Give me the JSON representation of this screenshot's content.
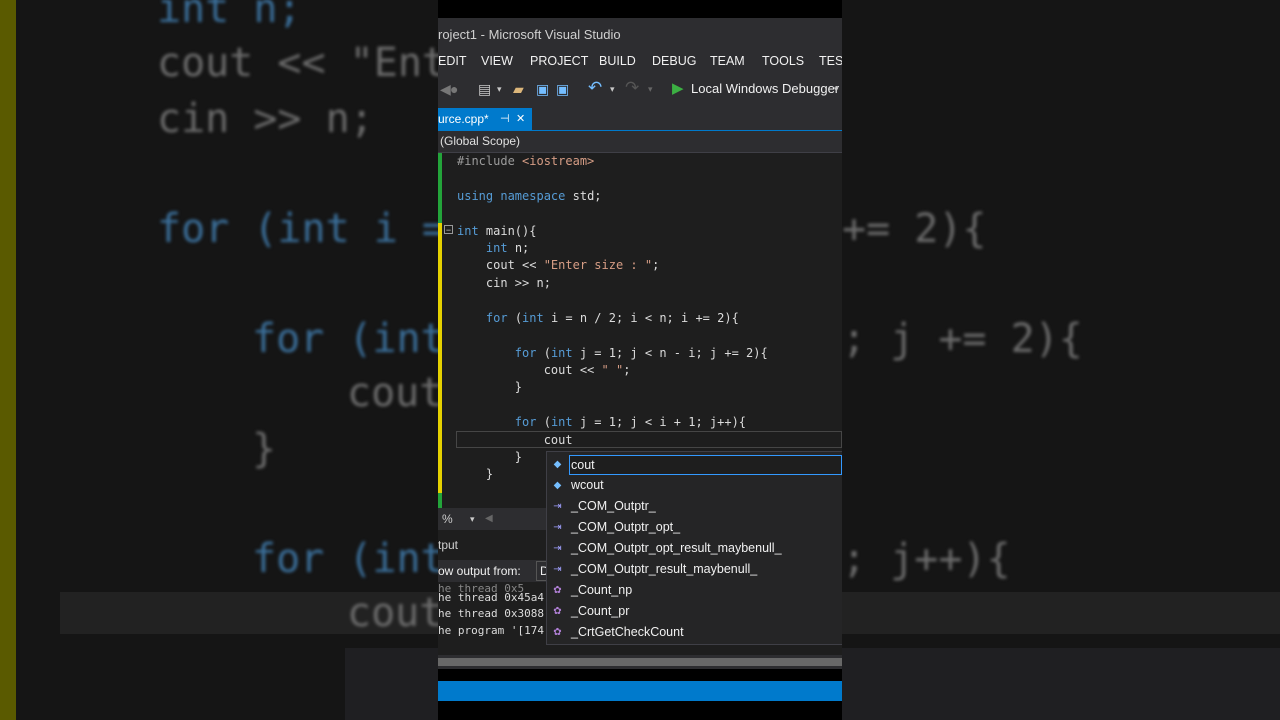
{
  "window": {
    "title": "roject1 - Microsoft Visual Studio"
  },
  "menu": [
    "EDIT",
    "VIEW",
    "PROJECT",
    "BUILD",
    "DEBUG",
    "TEAM",
    "TOOLS",
    "TEST"
  ],
  "toolbar": {
    "debugger_label": "Local Windows Debugger"
  },
  "tab": {
    "label": "urce.cpp*",
    "pin": "⊣",
    "close": "✕"
  },
  "scope": {
    "label": "(Global Scope)"
  },
  "code": [
    "#include <iostream>",
    "",
    "using namespace std;",
    "",
    "int main(){",
    "    int n;",
    "    cout << \"Enter size : \";",
    "    cin >> n;",
    "",
    "    for (int i = n / 2; i < n; i += 2){",
    "",
    "        for (int j = 1; j < n - i; j += 2){",
    "            cout << \" \";",
    "        }",
    "",
    "        for (int j = 1; j < i + 1; j++){",
    "            cout",
    "        }",
    "    }"
  ],
  "zoom": {
    "label": "%"
  },
  "output": {
    "title": "tput",
    "show_from_label": "ow output from:",
    "show_from_value": "D",
    "lines": [
      "he thread 0x5",
      "he thread 0x45a4",
      "he thread 0x3088",
      "he program '[174"
    ]
  },
  "intellisense": {
    "items": [
      {
        "label": "cout",
        "icon": "variable-icon"
      },
      {
        "label": "wcout",
        "icon": "variable-icon"
      },
      {
        "label": "_COM_Outptr_",
        "icon": "macro-icon"
      },
      {
        "label": "_COM_Outptr_opt_",
        "icon": "macro-icon"
      },
      {
        "label": "_COM_Outptr_opt_result_maybenull_",
        "icon": "macro-icon"
      },
      {
        "label": "_COM_Outptr_result_maybenull_",
        "icon": "macro-icon"
      },
      {
        "label": "_Count_np",
        "icon": "function-icon"
      },
      {
        "label": "_Count_pr",
        "icon": "function-icon"
      },
      {
        "label": "_CrtGetCheckCount",
        "icon": "function-icon"
      }
    ]
  },
  "background": {
    "lines": [
      "int n;",
      "cout << \"Ent",
      "cin >> n;",
      "for (int i =",
      "+= 2){",
      "for (int",
      "; j += 2){",
      "cout",
      "}",
      "for (int",
      "; j++){",
      "cout"
    ]
  },
  "colors": {
    "accent": "#007acc",
    "editor_bg": "#1e1e1e",
    "chrome_bg": "#2d2d30",
    "keyword": "#569cd6",
    "string": "#d69d85"
  }
}
